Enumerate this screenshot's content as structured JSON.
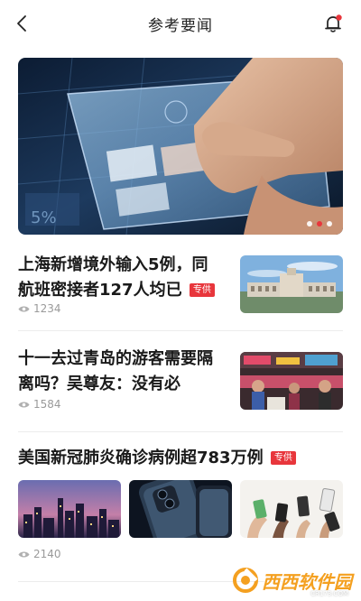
{
  "header": {
    "title": "参考要闻"
  },
  "hero": {
    "slide_count": 3,
    "active_slide": 2
  },
  "articles": [
    {
      "title_line1": "上海新增境外输入5例，同",
      "title_line2": "航班密接者127人均已",
      "tag": "专供",
      "views": "1234"
    },
    {
      "title_line1": "十一去过青岛的游客需要隔",
      "title_line2": "离吗？吴尊友：没有必",
      "views": "1584"
    },
    {
      "title": "美国新冠肺炎确诊病例超783万例",
      "tag": "专供",
      "views": "2140"
    }
  ],
  "watermark": {
    "text": "西西软件园",
    "sub": "CR173.COM"
  },
  "colors": {
    "accent": "#e8363c",
    "meta": "#9a9a9a",
    "watermark": "#f4a020"
  }
}
